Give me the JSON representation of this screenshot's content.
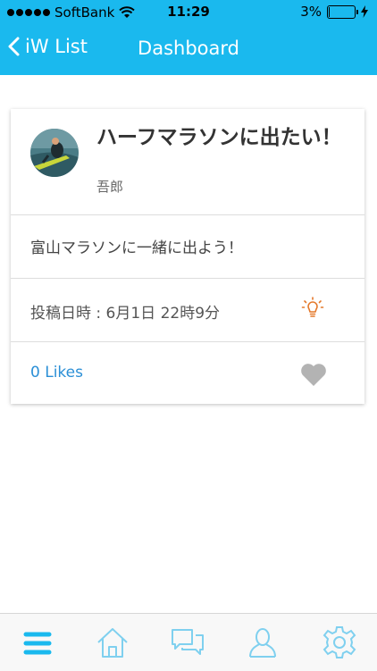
{
  "status_bar": {
    "carrier": "SoftBank",
    "time": "11:29",
    "battery_text": "3%",
    "battery_level": 0.03
  },
  "nav": {
    "back_label": "iW List",
    "title": "Dashboard"
  },
  "post": {
    "title": "ハーフマラソンに出たい！",
    "author": "吾郎",
    "message": "富山マラソンに一緒に出よう！",
    "date": "投稿日時 : 6月1日 22時9分",
    "likes": "0 Likes"
  },
  "tabs": [
    {
      "icon": "menu-icon",
      "active": true
    },
    {
      "icon": "home-icon"
    },
    {
      "icon": "chat-icon"
    },
    {
      "icon": "user-icon"
    },
    {
      "icon": "settings-icon"
    }
  ],
  "colors": {
    "primary": "#1ab9ee",
    "link": "#2b8fd6",
    "lightbulb": "#e4782a",
    "heart": "#b3b3b3",
    "tab_icon": "#7fd0ef",
    "tab_active": "#1ab9ee"
  }
}
